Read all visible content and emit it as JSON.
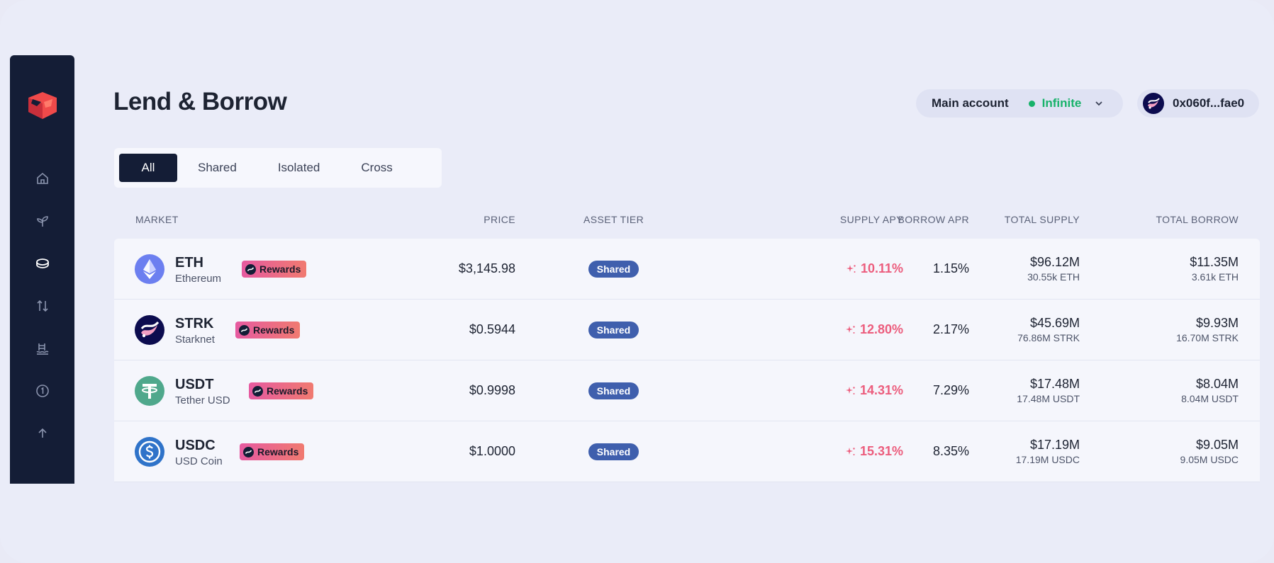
{
  "page": {
    "title": "Lend & Borrow"
  },
  "account": {
    "label": "Main account",
    "status": "Infinite"
  },
  "wallet": {
    "address": "0x060f...fae0"
  },
  "tabs": [
    {
      "label": "All",
      "active": true
    },
    {
      "label": "Shared",
      "active": false
    },
    {
      "label": "Isolated",
      "active": false
    },
    {
      "label": "Cross",
      "active": false
    }
  ],
  "table": {
    "headers": {
      "market": "MARKET",
      "price": "PRICE",
      "asset_tier": "ASSET TIER",
      "supply_apy": "SUPPLY APY",
      "borrow_apr": "BORROW APR",
      "total_supply": "TOTAL SUPPLY",
      "total_borrow": "TOTAL BORROW"
    },
    "rows": [
      {
        "symbol": "ETH",
        "name": "Ethereum",
        "icon": "ethereum-icon",
        "rewards": "Rewards",
        "price": "$3,145.98",
        "tier": "Shared",
        "supply_apy": "10.11%",
        "borrow_apr": "1.15%",
        "total_supply": "$96.12M",
        "total_supply_units": "30.55k ETH",
        "total_borrow": "$11.35M",
        "total_borrow_units": "3.61k ETH"
      },
      {
        "symbol": "STRK",
        "name": "Starknet",
        "icon": "starknet-icon",
        "rewards": "Rewards",
        "price": "$0.5944",
        "tier": "Shared",
        "supply_apy": "12.80%",
        "borrow_apr": "2.17%",
        "total_supply": "$45.69M",
        "total_supply_units": "76.86M STRK",
        "total_borrow": "$9.93M",
        "total_borrow_units": "16.70M STRK"
      },
      {
        "symbol": "USDT",
        "name": "Tether USD",
        "icon": "tether-icon",
        "rewards": "Rewards",
        "price": "$0.9998",
        "tier": "Shared",
        "supply_apy": "14.31%",
        "borrow_apr": "7.29%",
        "total_supply": "$17.48M",
        "total_supply_units": "17.48M USDT",
        "total_borrow": "$8.04M",
        "total_borrow_units": "8.04M USDT"
      },
      {
        "symbol": "USDC",
        "name": "USD Coin",
        "icon": "usdc-icon",
        "rewards": "Rewards",
        "price": "$1.0000",
        "tier": "Shared",
        "supply_apy": "15.31%",
        "borrow_apr": "8.35%",
        "total_supply": "$17.19M",
        "total_supply_units": "17.19M USDC",
        "total_borrow": "$9.05M",
        "total_borrow_units": "9.05M USDC"
      }
    ]
  },
  "colors": {
    "sidebar_bg": "#141d36",
    "accent_green": "#17b26a",
    "apy_pink": "#ec5d7d",
    "tier_blue": "#3f5fad",
    "logo_red": "#f04a4a"
  }
}
